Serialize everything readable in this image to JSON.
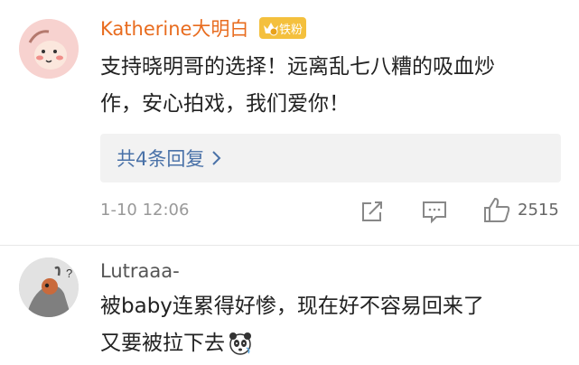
{
  "comments": [
    {
      "username": "Katherine大明白",
      "username_color": "#e86c1f",
      "badge_label": "铁粉",
      "text_lines": [
        "支持晓明哥的选择！远离乱七八糟的吸血炒",
        "作，安心拍戏，我们爱你！"
      ],
      "replies_label": "共4条回复",
      "time": "1-10 12:06",
      "like_count": "2515"
    },
    {
      "username": "Lutraaa-",
      "username_color": "#555555",
      "text_lines": [
        "被baby连累得好惨，现在好不容易回来了",
        "又要被拉下去"
      ]
    }
  ]
}
